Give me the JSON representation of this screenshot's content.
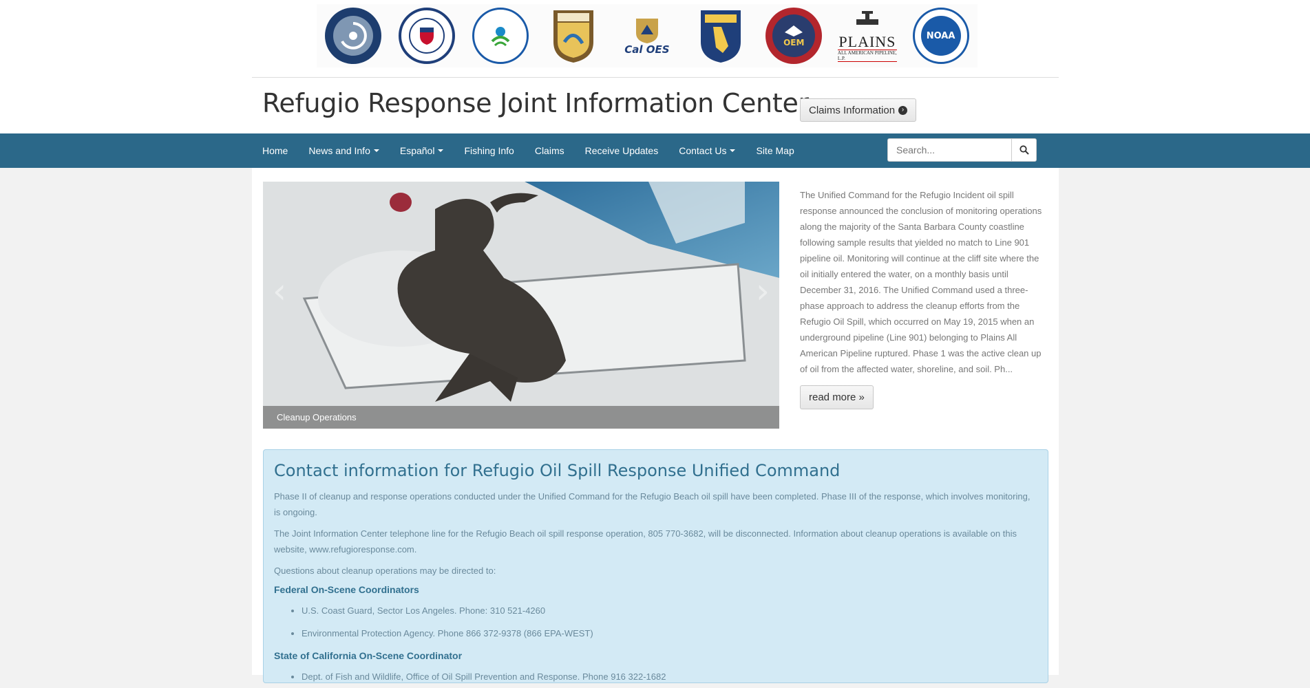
{
  "header": {
    "site_title": "Refugio Response Joint Information Center",
    "claims_button": "Claims Information",
    "agency_logos": [
      {
        "name": "Department of Transportation",
        "icon": "dot-seal-icon"
      },
      {
        "name": "United States Coast Guard",
        "icon": "uscg-seal-icon"
      },
      {
        "name": "Environmental Protection Agency",
        "icon": "epa-seal-icon"
      },
      {
        "name": "U.S. Fish & Wildlife Service",
        "icon": "usfws-shield-icon"
      },
      {
        "name": "Cal OES",
        "icon": "caloes-logo-icon",
        "text": "Cal OES"
      },
      {
        "name": "California Fish & Wildlife",
        "icon": "cdfw-shield-icon"
      },
      {
        "name": "Santa Barbara County OEM",
        "icon": "oem-seal-icon",
        "text": "OEM"
      },
      {
        "name": "Plains All American Pipeline",
        "icon": "plains-logo-icon",
        "text": "PLAINS"
      },
      {
        "name": "NOAA",
        "icon": "noaa-seal-icon",
        "text": "NOAA"
      }
    ]
  },
  "nav": {
    "items": [
      {
        "label": "Home",
        "dropdown": false
      },
      {
        "label": "News and Info",
        "dropdown": true
      },
      {
        "label": "Español",
        "dropdown": true
      },
      {
        "label": "Fishing Info",
        "dropdown": false
      },
      {
        "label": "Claims",
        "dropdown": false
      },
      {
        "label": "Receive Updates",
        "dropdown": false
      },
      {
        "label": "Contact Us",
        "dropdown": true
      },
      {
        "label": "Site Map",
        "dropdown": false
      }
    ],
    "search_placeholder": "Search..."
  },
  "carousel": {
    "caption": "Cleanup Operations",
    "prev": "‹",
    "next": "›"
  },
  "feature": {
    "text": "The Unified Command for the Refugio Incident oil spill response announced the conclusion of monitoring operations along the majority of the Santa Barbara County coastline following sample results that yielded no match to Line 901 pipeline oil. Monitoring will continue at the cliff site where the oil initially entered the water, on a monthly basis until December 31, 2016. The Unified Command used a three-phase approach to address the cleanup efforts from the Refugio Oil Spill, which occurred on May 19, 2015 when an underground pipeline (Line 901) belonging to Plains All American Pipeline ruptured. Phase 1 was the active clean up of oil from the affected water, shoreline, and soil. Ph...",
    "read_more": "read more »"
  },
  "contact_panel": {
    "heading": "Contact information for Refugio Oil Spill Response Unified Command",
    "p1": "Phase II of cleanup and response operations conducted under the Unified Command for the Refugio Beach oil spill have been completed. Phase III of the response, which involves monitoring, is ongoing.",
    "p2": "The Joint Information Center telephone line for the Refugio Beach oil spill response operation, 805 770-3682, will be disconnected. Information about cleanup operations is available on this website, www.refugioresponse.com.",
    "p3": "Questions about cleanup operations may be directed to:",
    "federal_heading": "Federal On-Scene Coordinators",
    "federal_items": [
      "U.S. Coast Guard, Sector Los Angeles. Phone: 310 521-4260",
      "Environmental Protection Agency. Phone 866 372-9378 (866 EPA-WEST)"
    ],
    "state_heading": "State of California On-Scene Coordinator",
    "state_items": [
      "Dept. of Fish and Wildlife, Office of Oil Spill Prevention and Response. Phone 916 322-1682"
    ]
  },
  "colors": {
    "navbar": "#2b6889",
    "panel_bg": "#d3eaf5",
    "panel_heading": "#31708f"
  }
}
